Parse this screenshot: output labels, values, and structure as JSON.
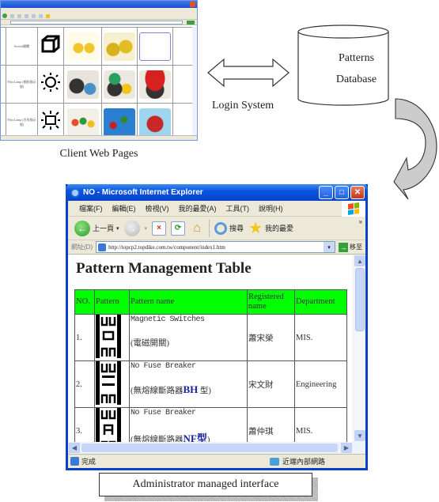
{
  "diagram": {
    "client_caption": "Client Web Pages",
    "login_label": "Login System",
    "database": {
      "line1": "Patterns",
      "line2": "Database"
    },
    "admin_caption": "Administrator managed interface"
  },
  "client_window": {
    "rows": [
      {
        "label": "Switch開關",
        "symbol": "cube"
      },
      {
        "label": "Pilot Lamp (圓形指示燈)",
        "symbol": "sun-circle"
      },
      {
        "label": "Pilot Lamp (方形指示燈)",
        "symbol": "sun-square"
      }
    ]
  },
  "ie_window": {
    "title": "NO - Microsoft Internet Explorer",
    "window_buttons": {
      "minimize": "_",
      "maximize": "□",
      "close": "✕"
    },
    "menu": [
      "檔案(F)",
      "編輯(E)",
      "檢視(V)",
      "我的最愛(A)",
      "工具(T)",
      "說明(H)"
    ],
    "toolbar": {
      "back_label": "上一頁",
      "search_label": "搜尋",
      "favorites_label": "我的最愛",
      "more": "»"
    },
    "address": {
      "label": "網址(D)",
      "url": "http://topcp2.topdike.com.tw/component/index1.htm",
      "go_label": "移至"
    },
    "page": {
      "title": "Pattern Management Table",
      "table": {
        "header_color": "#00ff00",
        "columns": [
          "NO.",
          "Pattern",
          "Pattern name",
          "Registered name",
          "Department"
        ],
        "rows": [
          {
            "no": "1.",
            "pattern_name_en": "Magnetic Switches",
            "pattern_name_zh": "(電磁開關)",
            "model": "",
            "model_suffix": "",
            "registered_name": "蕭宋榮",
            "department": "MIS."
          },
          {
            "no": "2.",
            "pattern_name_en": "No Fuse Breaker",
            "pattern_name_zh": "(無熔線斷路器",
            "model": "BH",
            "model_suffix": " 型)",
            "registered_name": "宋文財",
            "department": "Engineering"
          },
          {
            "no": "3.",
            "pattern_name_en": "No Fuse Breaker",
            "pattern_name_zh": "(無熔線斷路器",
            "model": "NF型",
            "model_suffix": ")",
            "registered_name": "蕭仲琪",
            "department": "MIS."
          }
        ]
      }
    },
    "status": {
      "left": "完成",
      "zone": "近端內部網路"
    }
  }
}
